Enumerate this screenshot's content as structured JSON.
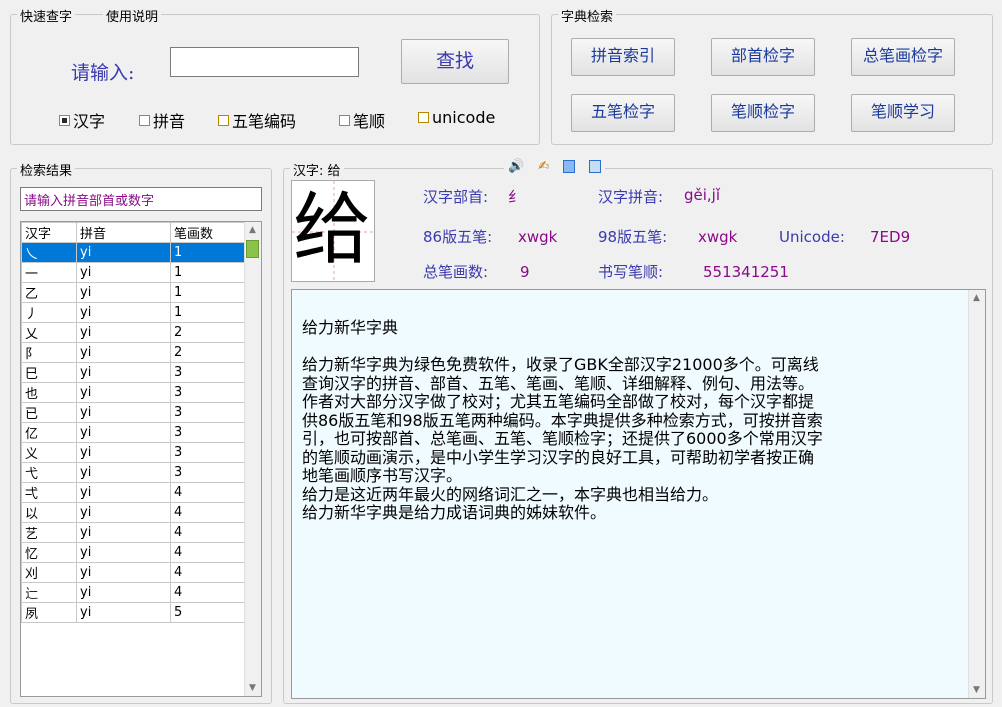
{
  "quick_lookup": {
    "title": "快速查字",
    "help_link": "使用说明",
    "input_label": "请输入:",
    "input_value": "",
    "search_button": "查找",
    "options": [
      {
        "label": "汉字",
        "checked": true
      },
      {
        "label": "拼音",
        "checked": false
      },
      {
        "label": "五笔编码",
        "checked": false
      },
      {
        "label": "笔顺",
        "checked": false
      },
      {
        "label": "unicode",
        "checked": false
      }
    ]
  },
  "dict_search": {
    "title": "字典检索",
    "buttons": [
      "拼音索引",
      "部首检字",
      "总笔画检字",
      "五笔检字",
      "笔顺检字",
      "笔顺学习"
    ]
  },
  "results": {
    "title": "检索结果",
    "filter_placeholder": "请输入拼音部首或数字",
    "columns": [
      "汉字",
      "拼音",
      "笔画数"
    ],
    "rows": [
      [
        "乀",
        "yi",
        "1"
      ],
      [
        "一",
        "yi",
        "1"
      ],
      [
        "乙",
        "yi",
        "1"
      ],
      [
        "丿",
        "yi",
        "1"
      ],
      [
        "乂",
        "yi",
        "2"
      ],
      [
        "阝",
        "yi",
        "2"
      ],
      [
        "巳",
        "yi",
        "3"
      ],
      [
        "也",
        "yi",
        "3"
      ],
      [
        "已",
        "yi",
        "3"
      ],
      [
        "亿",
        "yi",
        "3"
      ],
      [
        "义",
        "yi",
        "3"
      ],
      [
        "弋",
        "yi",
        "3"
      ],
      [
        "弌",
        "yi",
        "4"
      ],
      [
        "以",
        "yi",
        "4"
      ],
      [
        "艺",
        "yi",
        "4"
      ],
      [
        "忆",
        "yi",
        "4"
      ],
      [
        "刈",
        "yi",
        "4"
      ],
      [
        "辷",
        "yi",
        "4"
      ],
      [
        "夙",
        "yi",
        "5"
      ]
    ],
    "selected_index": 0
  },
  "detail": {
    "title": "汉字: 给",
    "character": "给",
    "radical_label": "汉字部首:",
    "radical_value": "纟",
    "pinyin_label": "汉字拼音:",
    "pinyin_value": "gěi,jǐ",
    "wubi86_label": "86版五笔:",
    "wubi86_value": "xwgk",
    "wubi98_label": "98版五笔:",
    "wubi98_value": "xwgk",
    "unicode_label": "Unicode:",
    "unicode_value": "7ED9",
    "strokes_label": "总笔画数:",
    "strokes_value": "9",
    "order_label": "书写笔顺:",
    "order_value": "551341251",
    "icons": [
      "speaker-icon",
      "edit-icon",
      "copy-icon",
      "paste-icon"
    ],
    "description_lines": [
      "给力新华字典",
      "",
      "给力新华字典为绿色免费软件，收录了GBK全部汉字21000多个。可离线",
      "查询汉字的拼音、部首、五笔、笔画、笔顺、详细解释、例句、用法等。",
      "作者对大部分汉字做了校对；尤其五笔编码全部做了校对，每个汉字都提",
      "供86版五笔和98版五笔两种编码。本字典提供多种检索方式，可按拼音索",
      "引，也可按部首、总笔画、五笔、笔顺检字；还提供了6000多个常用汉字",
      "的笔顺动画演示，是中小学生学习汉字的良好工具，可帮助初学者按正确",
      "地笔画顺序书写汉字。",
      "给力是这近两年最火的网络词汇之一，本字典也相当给力。",
      "给力新华字典是给力成语词典的姊妹软件。"
    ]
  }
}
